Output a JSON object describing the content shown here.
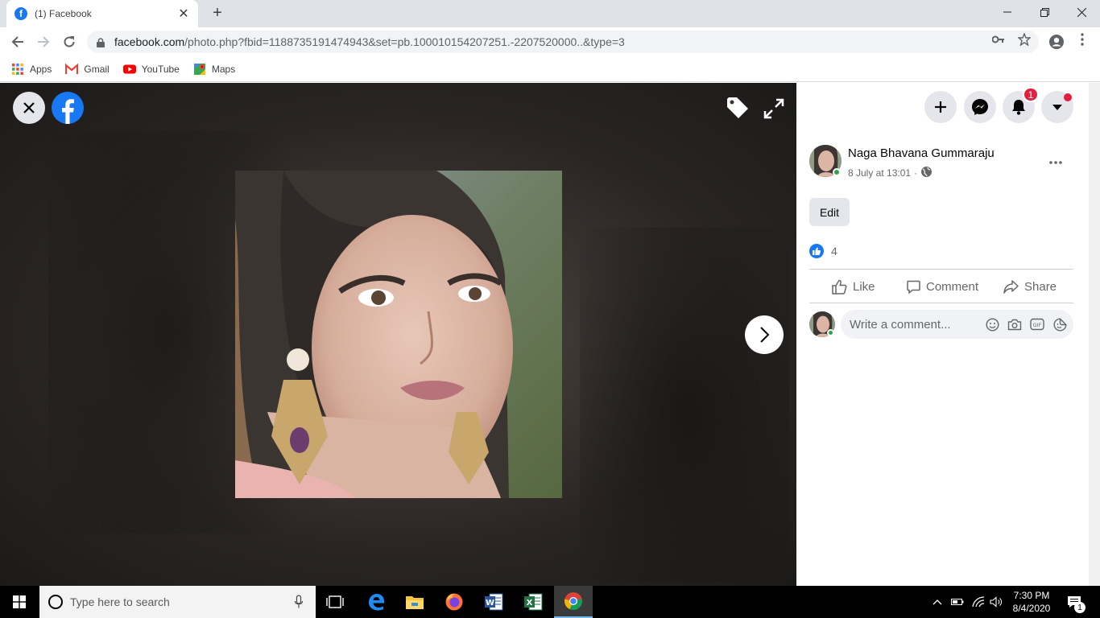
{
  "browser": {
    "tab_title": "(1) Facebook",
    "tab_favicon": "facebook-icon",
    "url_host": "facebook.com",
    "url_path": "/photo.php?fbid=1188735191474943&set=pb.100010154207251.-2207520000..&type=3",
    "bookmarks": [
      {
        "label": "Apps",
        "icon": "apps-grid-icon"
      },
      {
        "label": "Gmail",
        "icon": "gmail-icon"
      },
      {
        "label": "YouTube",
        "icon": "youtube-icon"
      },
      {
        "label": "Maps",
        "icon": "maps-icon"
      }
    ]
  },
  "header": {
    "notification_count": "1",
    "buttons": [
      "create-icon",
      "messenger-icon",
      "notifications-icon",
      "account-menu-icon"
    ]
  },
  "post": {
    "author": "Naga Bhavana Gummaraju",
    "date": "8 July at 13:01",
    "separator": "·",
    "privacy_icon": "globe-icon",
    "edit_label": "Edit",
    "like_count": "4",
    "actions": {
      "like": "Like",
      "comment": "Comment",
      "share": "Share"
    },
    "comment_placeholder": "Write a comment...",
    "gif_label": "GIF"
  },
  "taskbar": {
    "search_placeholder": "Type here to search",
    "time": "7:30 PM",
    "date": "8/4/2020",
    "notification_badge": "1",
    "apps": [
      "task-view-icon",
      "edge-icon",
      "file-explorer-icon",
      "firefox-icon",
      "word-icon",
      "excel-icon",
      "chrome-icon"
    ]
  },
  "colors": {
    "facebook_blue": "#1877f2",
    "notification_red": "#e41e3f",
    "online_green": "#31a24c"
  }
}
